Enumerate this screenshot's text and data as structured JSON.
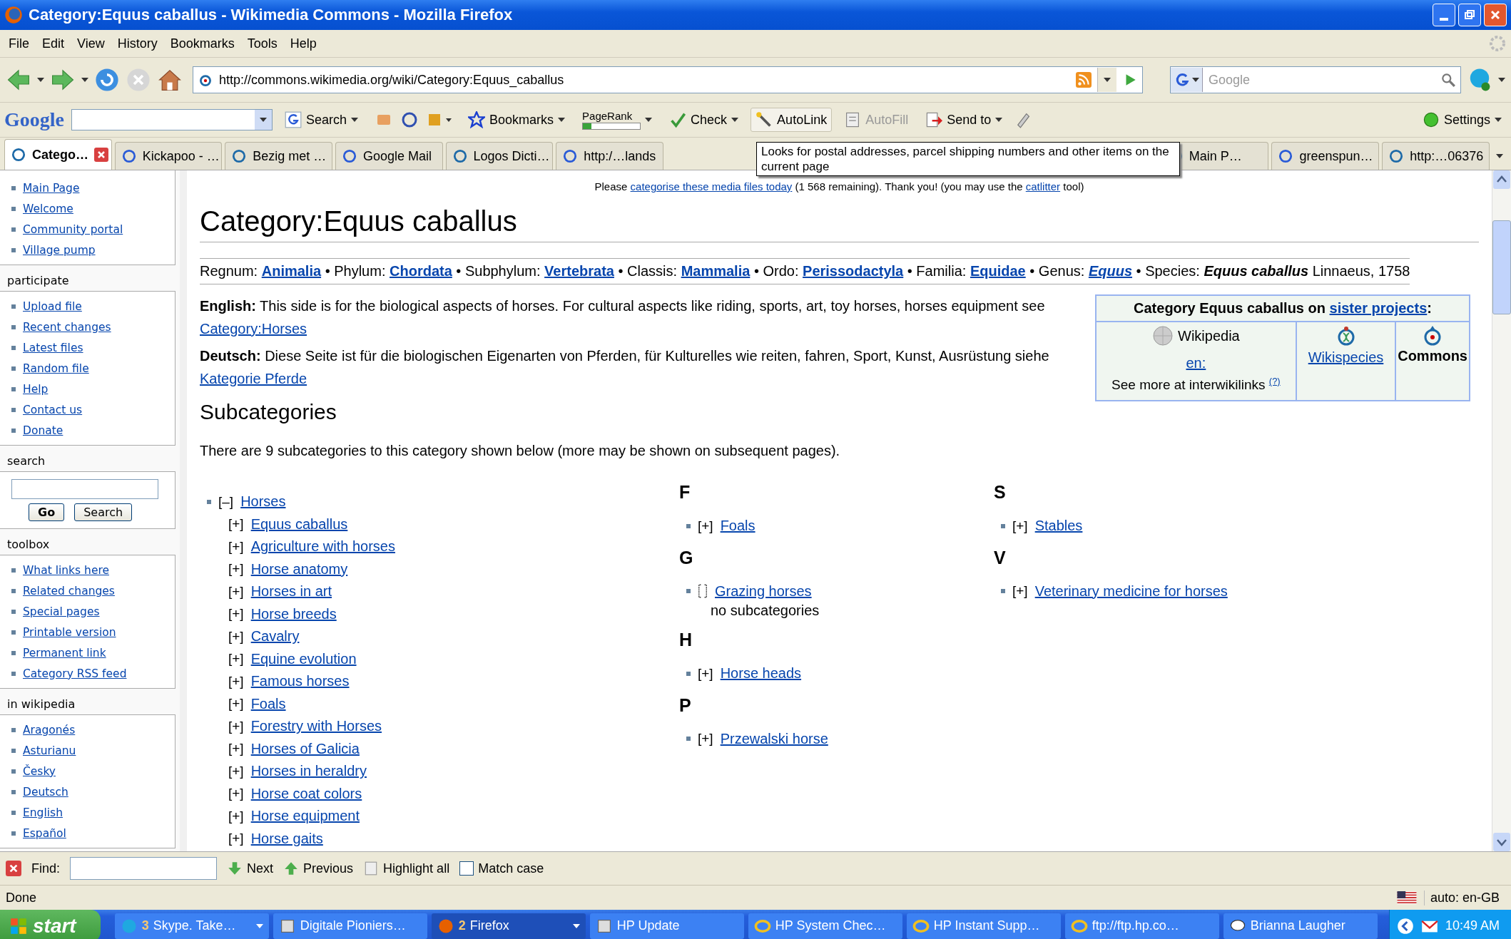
{
  "window": {
    "title": "Category:Equus caballus - Wikimedia Commons - Mozilla Firefox"
  },
  "menu": [
    "File",
    "Edit",
    "View",
    "History",
    "Bookmarks",
    "Tools",
    "Help"
  ],
  "address": {
    "value": "http://commons.wikimedia.org/wiki/Category:Equus_caballus"
  },
  "search_box": {
    "placeholder": "Google"
  },
  "google_toolbar": {
    "logo": "Google",
    "items": [
      {
        "kind": "search",
        "label": "Search",
        "dropdown": true,
        "disabled": false,
        "hovered": false
      },
      {
        "kind": "bookmarks",
        "label": "Bookmarks",
        "dropdown": true,
        "disabled": false,
        "hovered": false
      },
      {
        "kind": "pagerank",
        "label": "PageRank",
        "dropdown": true,
        "disabled": false,
        "hovered": false,
        "level": 0.15
      },
      {
        "kind": "check",
        "label": "Check",
        "dropdown": true,
        "disabled": false,
        "hovered": false
      },
      {
        "kind": "autolink",
        "label": "AutoLink",
        "dropdown": false,
        "disabled": false,
        "hovered": true
      },
      {
        "kind": "autofill",
        "label": "AutoFill",
        "dropdown": false,
        "disabled": true,
        "hovered": false
      },
      {
        "kind": "sendto",
        "label": "Send to",
        "dropdown": true,
        "disabled": false,
        "hovered": false
      }
    ],
    "settings": {
      "label": "Settings"
    }
  },
  "tabs": [
    {
      "label": "Catego…",
      "selected": true
    },
    {
      "label": "Kickapoo - …",
      "selected": false
    },
    {
      "label": "Bezig met …",
      "selected": false
    },
    {
      "label": "Google Mail",
      "selected": false
    },
    {
      "label": "Logos Dicti…",
      "selected": false
    },
    {
      "label": "http:/…lands",
      "selected": false
    },
    {
      "label": "Main P…",
      "selected": false
    },
    {
      "label": "greenspun…",
      "selected": false
    },
    {
      "label": "http:…06376",
      "selected": false
    }
  ],
  "tooltip": "Looks for postal addresses, parcel shipping numbers and other items on the current page",
  "sidebar": [
    {
      "items": [
        "Main Page",
        "Welcome",
        "Community portal",
        "Village pump"
      ]
    },
    {
      "title": "participate",
      "items": [
        "Upload file",
        "Recent changes",
        "Latest files",
        "Random file",
        "Help",
        "Contact us",
        "Donate"
      ]
    },
    {
      "title": "search",
      "kind": "search",
      "buttons": [
        "Go",
        "Search"
      ]
    },
    {
      "title": "toolbox",
      "items": [
        "What links here",
        "Related changes",
        "Special pages",
        "Printable version",
        "Permanent link",
        "Category RSS feed"
      ]
    },
    {
      "title": "in wikipedia",
      "items": [
        "Aragonés",
        "Asturianu",
        "Česky",
        "Deutsch",
        "English",
        "Español"
      ]
    }
  ],
  "notice": [
    {
      "kind": "text",
      "text": "Please "
    },
    {
      "kind": "link",
      "text": "categorise these media files today"
    },
    {
      "kind": "text",
      "text": " (1 568 remaining). Thank you! (you may use the "
    },
    {
      "kind": "link",
      "text": "catlitter"
    },
    {
      "kind": "text",
      "text": " tool)"
    }
  ],
  "heading": "Category:Equus caballus",
  "taxonomy": [
    {
      "kind": "text",
      "text": "Regnum: "
    },
    {
      "kind": "link",
      "text": "Animalia"
    },
    {
      "kind": "text",
      "text": " • Phylum: "
    },
    {
      "kind": "link",
      "text": "Chordata"
    },
    {
      "kind": "text",
      "text": " • Subphylum: "
    },
    {
      "kind": "link",
      "text": "Vertebrata"
    },
    {
      "kind": "text",
      "text": " • Classis: "
    },
    {
      "kind": "link",
      "text": "Mammalia"
    },
    {
      "kind": "text",
      "text": " • Ordo: "
    },
    {
      "kind": "link",
      "text": "Perissodactyla"
    },
    {
      "kind": "text",
      "text": " • Familia: "
    },
    {
      "kind": "link",
      "text": "Equidae"
    },
    {
      "kind": "text",
      "text": " • Genus: "
    },
    {
      "kind": "italic-link",
      "text": "Equus"
    },
    {
      "kind": "text",
      "text": " • Species: "
    },
    {
      "kind": "italic",
      "text": "Equus caballus"
    },
    {
      "kind": "text",
      "text": " Linnaeus, 1758"
    }
  ],
  "descriptions": [
    {
      "lang": "English:",
      "parts": [
        {
          "kind": "text",
          "text": " This side is for the biological aspects of horses. For cultural aspects like riding, sports, art, toy horses, horses equipment see "
        },
        {
          "kind": "link",
          "text": "Category:Horses"
        }
      ]
    },
    {
      "lang": "Deutsch:",
      "parts": [
        {
          "kind": "text",
          "text": " Diese Seite ist für die biologischen Eigenarten von Pferden, für Kulturelles wie reiten, fahren, Sport, Kunst, Ausrüstung siehe "
        },
        {
          "kind": "link",
          "text": "Kategorie Pferde"
        }
      ]
    }
  ],
  "sister_box": {
    "title": "Category Equus caballus on ",
    "title_link": "sister projects",
    "title_end": ":",
    "cells": [
      {
        "kind": "wikipedia",
        "label": "Wikipedia",
        "link": "en:",
        "more": "See more at interwikilinks",
        "help": "(?)"
      },
      {
        "kind": "wikispecies",
        "label": "Wikispecies"
      },
      {
        "kind": "commons",
        "label": "Commons"
      }
    ]
  },
  "subcategories": {
    "heading": "Subcategories",
    "count": "There are 9 subcategories to this category shown below (more may be shown on subsequent pages).",
    "columns": [
      {
        "groups": [
          {
            "items": [
              {
                "kind": "expandable",
                "toggle": "[–]",
                "label": "Horses",
                "children": [
                  {
                    "kind": "expandable",
                    "toggle": "[+]",
                    "label": "Equus caballus"
                  },
                  {
                    "kind": "expandable",
                    "toggle": "[+]",
                    "label": "Agriculture with horses"
                  },
                  {
                    "kind": "expandable",
                    "toggle": "[+]",
                    "label": "Horse anatomy"
                  },
                  {
                    "kind": "expandable",
                    "toggle": "[+]",
                    "label": "Horses in art"
                  },
                  {
                    "kind": "expandable",
                    "toggle": "[+]",
                    "label": "Horse breeds"
                  },
                  {
                    "kind": "expandable",
                    "toggle": "[+]",
                    "label": "Cavalry"
                  },
                  {
                    "kind": "expandable",
                    "toggle": "[+]",
                    "label": "Equine evolution"
                  },
                  {
                    "kind": "expandable",
                    "toggle": "[+]",
                    "label": "Famous horses"
                  },
                  {
                    "kind": "expandable",
                    "toggle": "[+]",
                    "label": "Foals"
                  },
                  {
                    "kind": "expandable",
                    "toggle": "[+]",
                    "label": "Forestry with Horses"
                  },
                  {
                    "kind": "expandable",
                    "toggle": "[+]",
                    "label": "Horses of Galicia"
                  },
                  {
                    "kind": "expandable",
                    "toggle": "[+]",
                    "label": "Horses in heraldry"
                  },
                  {
                    "kind": "expandable",
                    "toggle": "[+]",
                    "label": "Horse coat colors"
                  },
                  {
                    "kind": "expandable",
                    "toggle": "[+]",
                    "label": "Horse equipment"
                  },
                  {
                    "kind": "expandable",
                    "toggle": "[+]",
                    "label": "Horse gaits"
                  }
                ]
              }
            ]
          }
        ]
      },
      {
        "groups": [
          {
            "letter": "F",
            "items": [
              {
                "kind": "expandable",
                "toggle": "[+]",
                "label": "Foals"
              }
            ]
          },
          {
            "letter": "G",
            "items": [
              {
                "kind": "empty",
                "label": "Grazing horses",
                "note": "no subcategories"
              }
            ]
          },
          {
            "letter": "H",
            "items": [
              {
                "kind": "expandable",
                "toggle": "[+]",
                "label": "Horse heads"
              }
            ]
          },
          {
            "letter": "P",
            "items": [
              {
                "kind": "expandable",
                "toggle": "[+]",
                "label": "Przewalski horse"
              }
            ]
          }
        ]
      },
      {
        "groups": [
          {
            "letter": "S",
            "items": [
              {
                "kind": "expandable",
                "toggle": "[+]",
                "label": "Stables"
              }
            ]
          },
          {
            "letter": "V",
            "items": [
              {
                "kind": "expandable",
                "toggle": "[+]",
                "label": "Veterinary medicine for horses"
              }
            ]
          }
        ]
      }
    ]
  },
  "find_bar": {
    "label": "Find:",
    "next": "Next",
    "previous": "Previous",
    "highlight": "Highlight all",
    "match_case": {
      "label": "Match case",
      "checked": false
    }
  },
  "status_bar": {
    "text": "Done",
    "language": "auto: en-GB"
  },
  "taskbar": {
    "start": "start",
    "items": [
      {
        "count": "3",
        "label": "Skype. Take…",
        "dropdown": true,
        "selected": false,
        "kind": "skype"
      },
      {
        "label": "Digitale Pioniers…",
        "dropdown": false,
        "selected": false,
        "kind": "app"
      },
      {
        "count": "2",
        "label": "Firefox",
        "dropdown": true,
        "selected": true,
        "kind": "firefox"
      },
      {
        "label": "HP Update",
        "dropdown": false,
        "selected": false,
        "kind": "app"
      },
      {
        "label": "HP System Chec…",
        "dropdown": false,
        "selected": false,
        "kind": "ie"
      },
      {
        "label": "HP Instant Supp…",
        "dropdown": false,
        "selected": false,
        "kind": "ie"
      },
      {
        "label": "ftp://ftp.hp.co…",
        "dropdown": false,
        "selected": false,
        "kind": "ie"
      },
      {
        "label": "Brianna Laugher",
        "dropdown": false,
        "selected": false,
        "kind": "chat"
      }
    ],
    "clock": "10:49 AM"
  }
}
